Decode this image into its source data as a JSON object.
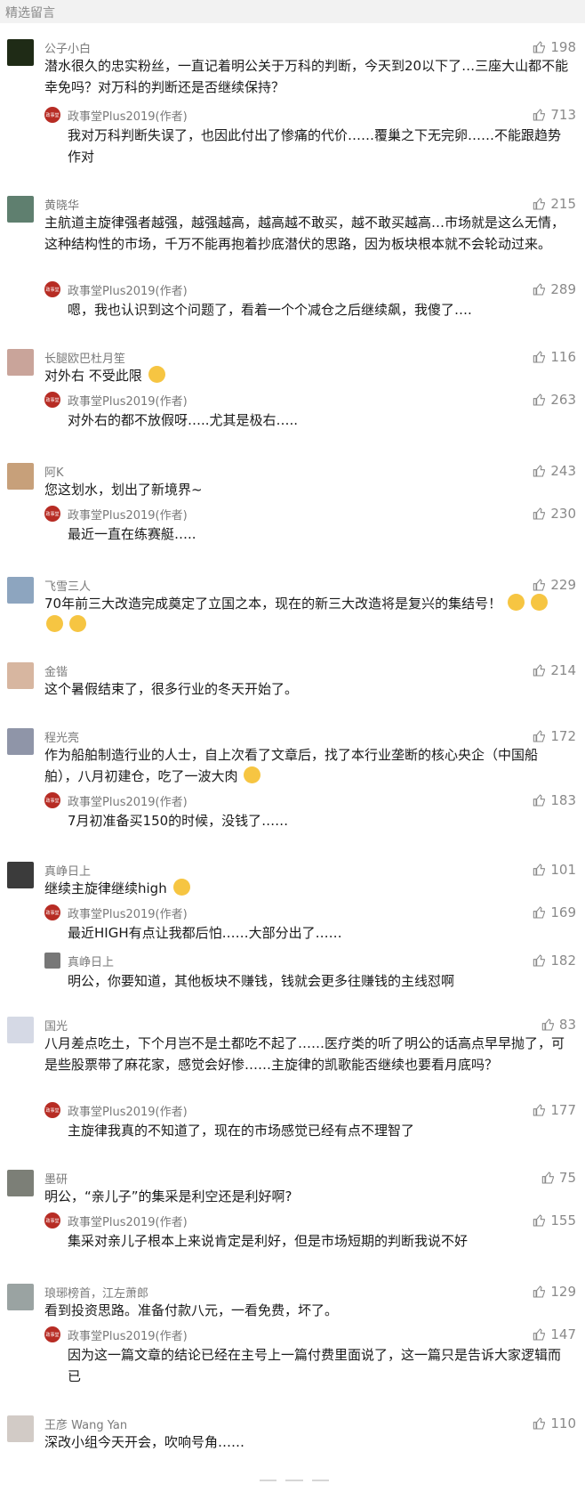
{
  "section_title": "精选留言",
  "comments": [
    {
      "name": "公子小白",
      "likes": "198",
      "text": "潜水很久的忠实粉丝，一直记着明公关于万科的判断，今天到20以下了…三座大山都不能幸免吗？对万科的判断还是否继续保持？",
      "replies": [
        {
          "name": "政事堂Plus2019(作者)",
          "likes": "713",
          "text": "我对万科判断失误了，也因此付出了惨痛的代价……覆巢之下无完卵……不能跟趋势作对"
        }
      ]
    },
    {
      "name": "黄晓华",
      "likes": "215",
      "text": "主航道主旋律强者越强，越强越高，越高越不敢买，越不敢买越高…市场就是这么无情，这种结构性的市场，千万不能再抱着抄底潜伏的思路，因为板块根本就不会轮动过来。",
      "replies": [
        {
          "name": "政事堂Plus2019(作者)",
          "likes": "289",
          "text": "嗯，我也认识到这个问题了，看着一个个减仓之后继续飙，我傻了…."
        }
      ]
    },
    {
      "name": "长腿欧巴杜月笙",
      "likes": "116",
      "text": "对外右 不受此限",
      "replies": [
        {
          "name": "政事堂Plus2019(作者)",
          "likes": "263",
          "text": "对外右的都不放假呀…..尤其是极右….."
        }
      ]
    },
    {
      "name": "阿K",
      "likes": "243",
      "text": "您这划水，划出了新境界~",
      "replies": [
        {
          "name": "政事堂Plus2019(作者)",
          "likes": "230",
          "text": "最近一直在练赛艇….."
        }
      ]
    },
    {
      "name": "飞雪三人",
      "likes": "229",
      "text": "70年前三大改造完成奠定了立国之本，现在的新三大改造将是复兴的集结号！",
      "replies": []
    },
    {
      "name": "金锴",
      "likes": "214",
      "text": "这个暑假结束了，很多行业的冬天开始了。",
      "replies": []
    },
    {
      "name": "程光亮",
      "likes": "172",
      "text": "作为船舶制造行业的人士，自上次看了文章后，找了本行业垄断的核心央企（中国船舶），八月初建仓，吃了一波大肉",
      "replies": [
        {
          "name": "政事堂Plus2019(作者)",
          "likes": "183",
          "text": "7月初准备买150的时候，没钱了……"
        }
      ]
    },
    {
      "name": "真峥日上",
      "likes": "101",
      "text": "继续主旋律继续high",
      "replies": [
        {
          "name": "政事堂Plus2019(作者)",
          "likes": "169",
          "text": "最近HIGH有点让我都后怕……大部分出了……"
        },
        {
          "name": "真峥日上",
          "likes": "182",
          "text": "明公，你要知道，其他板块不赚钱，钱就会更多往赚钱的主线怼啊"
        }
      ]
    },
    {
      "name": "国光",
      "likes": "83",
      "text": "八月差点吃土，下个月岂不是土都吃不起了……医疗类的听了明公的话高点早早抛了，可是些股票带了麻花家，感觉会好惨……主旋律的凯歌能否继续也要看月底吗？",
      "replies": [
        {
          "name": "政事堂Plus2019(作者)",
          "likes": "177",
          "text": "主旋律我真的不知道了，现在的市场感觉已经有点不理智了"
        }
      ]
    },
    {
      "name": "墨研",
      "likes": "75",
      "text": "明公，“亲儿子”的集采是利空还是利好啊?",
      "replies": [
        {
          "name": "政事堂Plus2019(作者)",
          "likes": "155",
          "text": "集采对亲儿子根本上来说肯定是利好，但是市场短期的判断我说不好"
        }
      ]
    },
    {
      "name": "琅琊榜首，江左萧郎",
      "likes": "129",
      "text": "看到投资思路。准备付款八元，一看免费，坏了。",
      "replies": [
        {
          "name": "政事堂Plus2019(作者)",
          "likes": "147",
          "text": "因为这一篇文章的结论已经在主号上一篇付费里面说了，这一篇只是告诉大家逻辑而已"
        }
      ]
    },
    {
      "name": "王彦 Wang Yan",
      "likes": "110",
      "text": "深改小组今天开会，吹响号角……",
      "replies": []
    }
  ],
  "colors": {
    "text": "#1a1a1a",
    "meta": "#7a7a7a",
    "author_badge": "#b72c24",
    "header_bg": "#f2f2f2"
  },
  "icons": {
    "like": "thumbs-up-icon"
  }
}
